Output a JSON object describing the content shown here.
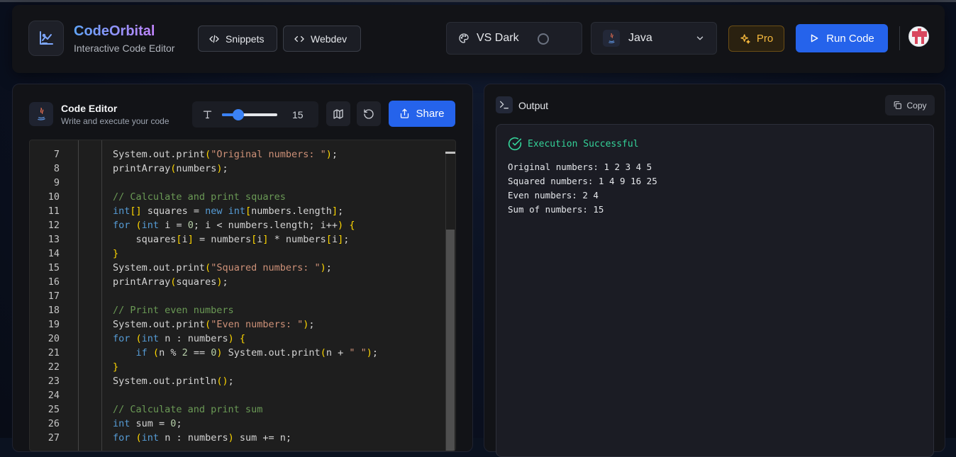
{
  "brand": {
    "title": "CodeOrbital",
    "subtitle": "Interactive Code Editor"
  },
  "header": {
    "snippets_label": "Snippets",
    "webdev_label": "Webdev",
    "theme_label": "VS Dark",
    "language_label": "Java",
    "pro_label": "Pro",
    "run_label": "Run Code"
  },
  "editor": {
    "title": "Code Editor",
    "subtitle": "Write and execute your code",
    "font_size": "15",
    "font_size_fraction": 0.3,
    "share_label": "Share",
    "lines": [
      {
        "n": "7",
        "t": "System.out.print(\"Original numbers: \");"
      },
      {
        "n": "8",
        "t": "printArray(numbers);"
      },
      {
        "n": "9",
        "t": ""
      },
      {
        "n": "10",
        "t": "// Calculate and print squares"
      },
      {
        "n": "11",
        "t": "int[] squares = new int[numbers.length];"
      },
      {
        "n": "12",
        "t": "for (int i = 0; i < numbers.length; i++) {"
      },
      {
        "n": "13",
        "t": "    squares[i] = numbers[i] * numbers[i];"
      },
      {
        "n": "14",
        "t": "}"
      },
      {
        "n": "15",
        "t": "System.out.print(\"Squared numbers: \");"
      },
      {
        "n": "16",
        "t": "printArray(squares);"
      },
      {
        "n": "17",
        "t": ""
      },
      {
        "n": "18",
        "t": "// Print even numbers"
      },
      {
        "n": "19",
        "t": "System.out.print(\"Even numbers: \");"
      },
      {
        "n": "20",
        "t": "for (int n : numbers) {"
      },
      {
        "n": "21",
        "t": "    if (n % 2 == 0) System.out.print(n + \" \");"
      },
      {
        "n": "22",
        "t": "}"
      },
      {
        "n": "23",
        "t": "System.out.println();"
      },
      {
        "n": "24",
        "t": ""
      },
      {
        "n": "25",
        "t": "// Calculate and print sum"
      },
      {
        "n": "26",
        "t": "int sum = 0;"
      },
      {
        "n": "27",
        "t": "for (int n : numbers) sum += n;"
      }
    ]
  },
  "output": {
    "title": "Output",
    "copy_label": "Copy",
    "status": "Execution Successful",
    "lines": [
      "Original numbers: 1 2 3 4 5",
      "Squared numbers: 1 4 9 16 25",
      "Even numbers: 2 4",
      "Sum of numbers: 15"
    ]
  },
  "colors": {
    "accent": "#2563eb",
    "success": "#34d399",
    "pro": "#f5b83d"
  }
}
